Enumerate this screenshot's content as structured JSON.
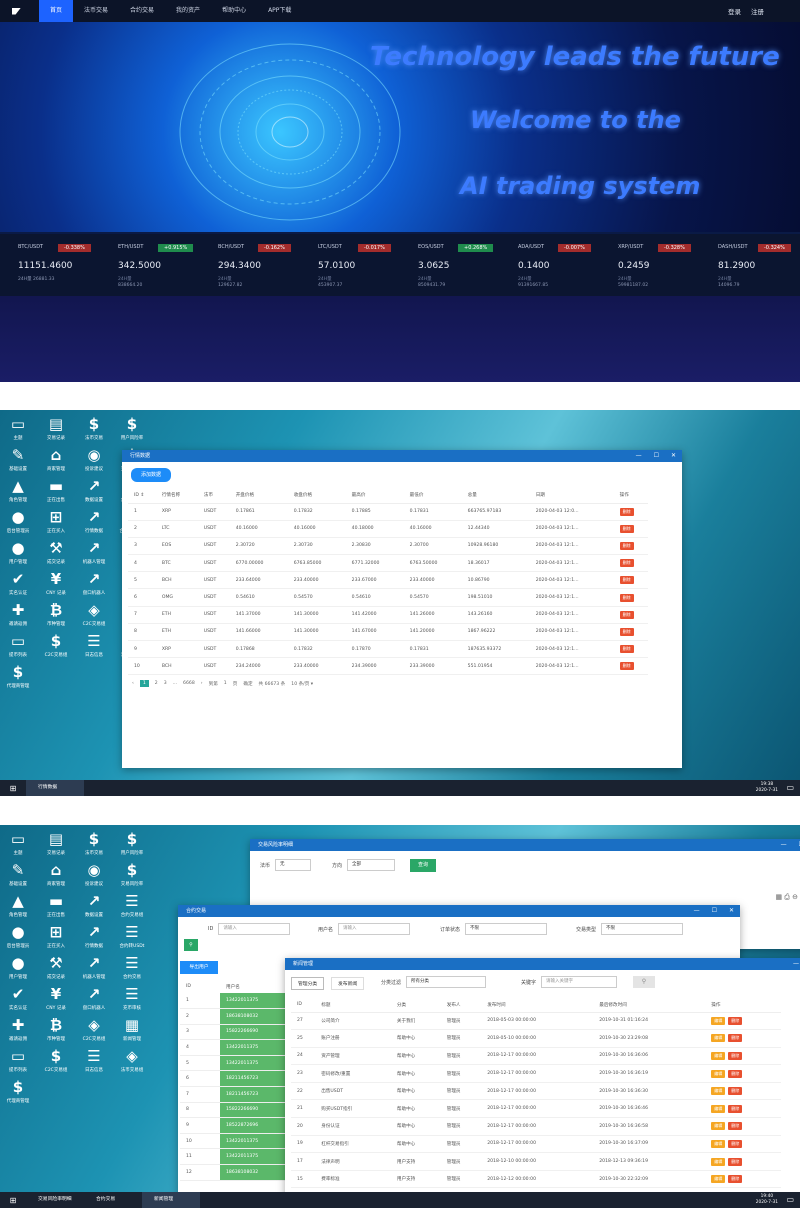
{
  "site": {
    "nav": [
      "首页",
      "法币交易",
      "合约交易",
      "我的资产",
      "帮助中心",
      "APP下载"
    ],
    "auth": [
      "登录",
      "注册"
    ],
    "hero_lines": [
      "Technology leads the future",
      "Welcome to the",
      "AI trading system"
    ],
    "tickers": [
      {
        "sym": "BTC/USDT",
        "chg": "-0.338%",
        "dir": "dn",
        "price": "11151.4600",
        "vol_label": "24H量",
        "vol": "24H量 26881.33"
      },
      {
        "sym": "ETH/USDT",
        "chg": "+0.915%",
        "dir": "up",
        "price": "342.5000",
        "vol_label": "24H量",
        "vol": "838664.20"
      },
      {
        "sym": "BCH/USDT",
        "chg": "-0.162%",
        "dir": "dn",
        "price": "294.3400",
        "vol_label": "24H量",
        "vol": "129627.82"
      },
      {
        "sym": "LTC/USDT",
        "chg": "-0.017%",
        "dir": "dn",
        "price": "57.0100",
        "vol_label": "24H量",
        "vol": "453907.37"
      },
      {
        "sym": "EOS/USDT",
        "chg": "+0.268%",
        "dir": "up",
        "price": "3.0625",
        "vol_label": "24H量",
        "vol": "8509431.79"
      },
      {
        "sym": "ADA/USDT",
        "chg": "-0.007%",
        "dir": "dn",
        "price": "0.1400",
        "vol_label": "24H量",
        "vol": "91391667.85"
      },
      {
        "sym": "XRP/USDT",
        "chg": "-0.328%",
        "dir": "dn",
        "price": "0.2459",
        "vol_label": "24H量",
        "vol": "59981187.02"
      },
      {
        "sym": "DASH/USDT",
        "chg": "-0.324%",
        "dir": "dn",
        "price": "81.2900",
        "vol_label": "24H量",
        "vol": "14096.79"
      }
    ]
  },
  "desktop_icons": [
    {
      "label": "主题",
      "icon": "monitor-icon",
      "g": "▭"
    },
    {
      "label": "交易记录",
      "icon": "document-icon",
      "g": "▤"
    },
    {
      "label": "法币交易",
      "icon": "dollar-icon",
      "g": "$"
    },
    {
      "label": "用户风险率",
      "icon": "dollar-icon",
      "g": "$"
    },
    {
      "label": "基础设置",
      "icon": "wrench-icon",
      "g": "✎"
    },
    {
      "label": "商家管理",
      "icon": "bank-icon",
      "g": "⌂"
    },
    {
      "label": "投诉建议",
      "icon": "broadcast-icon",
      "g": "◉"
    },
    {
      "label": "交易风险率",
      "icon": "dollar-icon",
      "g": "$"
    },
    {
      "label": "角色管理",
      "icon": "graduation-icon",
      "g": "▲"
    },
    {
      "label": "正在出售",
      "icon": "tray-icon",
      "g": "▬"
    },
    {
      "label": "数据设置",
      "icon": "chart-icon",
      "g": "↗"
    },
    {
      "label": "合约交易组",
      "icon": "list-icon",
      "g": "☰"
    },
    {
      "label": "后台管理员",
      "icon": "user-icon",
      "g": "●"
    },
    {
      "label": "正在买入",
      "icon": "cart-icon",
      "g": "⊞"
    },
    {
      "label": "行情数据",
      "icon": "chart-icon",
      "g": "↗"
    },
    {
      "label": "合约转USDt",
      "icon": "list-icon",
      "g": "☰"
    },
    {
      "label": "用户管理",
      "icon": "users-icon",
      "g": "●"
    },
    {
      "label": "成交记录",
      "icon": "gavel-icon",
      "g": "⚒"
    },
    {
      "label": "机器人管理",
      "icon": "chart-icon",
      "g": "↗"
    },
    {
      "label": "合约交易",
      "icon": "list-icon",
      "g": "☰"
    },
    {
      "label": "实名认证",
      "icon": "check-icon",
      "g": "✔"
    },
    {
      "label": "CNY 记录",
      "icon": "yen-icon",
      "g": "¥"
    },
    {
      "label": "盘口机器人",
      "icon": "chart-icon",
      "g": "↗"
    },
    {
      "label": "充币审核",
      "icon": "list-icon",
      "g": "☰"
    },
    {
      "label": "邀请返佣",
      "icon": "user-plus-icon",
      "g": "✚"
    },
    {
      "label": "币种管理",
      "icon": "bitcoin-icon",
      "g": "₿"
    },
    {
      "label": "C2C交易组",
      "icon": "c2c-icon",
      "g": "◈"
    },
    {
      "label": "新闻管理",
      "icon": "news-icon",
      "g": "▦"
    },
    {
      "label": "提币列表",
      "icon": "card-icon",
      "g": "▭"
    },
    {
      "label": "C2C交易组",
      "icon": "dollar-icon",
      "g": "$"
    },
    {
      "label": "日志信息",
      "icon": "list-icon",
      "g": "☰"
    },
    {
      "label": "法币交易组",
      "icon": "c2c-icon",
      "g": "◈"
    },
    {
      "label": "代理商管理",
      "icon": "dollar-icon",
      "g": "$"
    }
  ],
  "win_market": {
    "title": "行情数据",
    "add_label": "添加数据",
    "headers": [
      "ID ⇕",
      "行情名称",
      "法币",
      "开盘价格",
      "收盘价格",
      "最高价",
      "最低价",
      "总量",
      "日期",
      "操作"
    ],
    "rows": [
      [
        "1",
        "XRP",
        "USDT",
        "0.17861",
        "0.17832",
        "0.17885",
        "0.17831",
        "663765.97183",
        "2020-04-03 12:0..."
      ],
      [
        "2",
        "LTC",
        "USDT",
        "40.16000",
        "40.16000",
        "40.18000",
        "40.16000",
        "12.44340",
        "2020-04-03 12:1..."
      ],
      [
        "3",
        "EOS",
        "USDT",
        "2.30720",
        "2.30730",
        "2.30830",
        "2.30700",
        "10928.96180",
        "2020-04-03 12:1..."
      ],
      [
        "4",
        "BTC",
        "USDT",
        "6770.00000",
        "6763.85000",
        "6771.32000",
        "6763.50000",
        "18.36017",
        "2020-04-03 12:1..."
      ],
      [
        "5",
        "BCH",
        "USDT",
        "233.64000",
        "233.40000",
        "233.67000",
        "233.40000",
        "10.86790",
        "2020-04-03 12:1..."
      ],
      [
        "6",
        "OMG",
        "USDT",
        "0.54610",
        "0.54570",
        "0.54610",
        "0.54570",
        "198.51010",
        "2020-04-03 12:1..."
      ],
      [
        "7",
        "ETH",
        "USDT",
        "141.37000",
        "141.30000",
        "141.42000",
        "141.26000",
        "143.26160",
        "2020-04-03 12:1..."
      ],
      [
        "8",
        "ETH",
        "USDT",
        "141.66000",
        "141.30000",
        "141.67000",
        "141.20000",
        "1867.96222",
        "2020-04-03 12:1..."
      ],
      [
        "9",
        "XRP",
        "USDT",
        "0.17868",
        "0.17832",
        "0.17870",
        "0.17831",
        "187635.93372",
        "2020-04-03 12:1..."
      ],
      [
        "10",
        "BCH",
        "USDT",
        "234.24000",
        "233.40000",
        "234.39000",
        "233.39000",
        "551.01954",
        "2020-04-03 12:1..."
      ]
    ],
    "del_label": "删除",
    "pager": {
      "pages": [
        "1",
        "2",
        "3",
        "...",
        "6668"
      ],
      "goto": "到第",
      "page_input": "1",
      "page_unit": "页",
      "confirm": "确定",
      "total": "共 66673 条",
      "per_page": "10 条/页 ▾"
    }
  },
  "taskbar1": {
    "item": "行情数据",
    "time": "19:38",
    "date": "2020-7-31"
  },
  "win_risk": {
    "title": "交易风险率明细",
    "f1_label": "法币",
    "f1_value": "无",
    "f2_label": "方向",
    "f2_value": "全部",
    "query": "查询"
  },
  "win_contract": {
    "title": "合约交易",
    "id_label": "ID",
    "id_ph": "请输入",
    "user_label": "用户名",
    "user_ph": "请输入",
    "status_label": "订单状态",
    "status_value": "不限",
    "type_label": "交易类型",
    "type_value": "不限",
    "export": "导出用户",
    "col_id": "ID",
    "col_user": "用户名",
    "rows": [
      [
        "1",
        "13422011375"
      ],
      [
        "2",
        "18638108032"
      ],
      [
        "3",
        "15822266690"
      ],
      [
        "4",
        "13422011375"
      ],
      [
        "5",
        "13422011375"
      ],
      [
        "6",
        "18211456723"
      ],
      [
        "7",
        "18211456723"
      ],
      [
        "8",
        "15822266690"
      ],
      [
        "9",
        "18522872696"
      ],
      [
        "10",
        "13422011375"
      ],
      [
        "11",
        "13422011375"
      ],
      [
        "12",
        "18638108032"
      ]
    ]
  },
  "win_news": {
    "title": "新闻管理",
    "tab1": "管理分类",
    "tab2": "发布新闻",
    "filter_label": "分类过滤",
    "filter_value": "所有分类",
    "kw_label": "关键字",
    "kw_ph": "请输入关键字",
    "headers": [
      "ID",
      "标题",
      "分类",
      "发布人",
      "发布时间",
      "最后修改时间",
      "操作"
    ],
    "rows": [
      [
        "27",
        "公司简介",
        "关于我们",
        "管理员",
        "2018-05-03 00:00:00",
        "2019-10-31 01:16:24"
      ],
      [
        "25",
        "账户注册",
        "帮助中心",
        "管理员",
        "2018-05-10 00:00:00",
        "2019-10-30 23:29:08"
      ],
      [
        "24",
        "资产管理",
        "帮助中心",
        "管理员",
        "2018-12-17 00:00:00",
        "2019-10-30 16:36:06"
      ],
      [
        "23",
        "密码修改/重置",
        "帮助中心",
        "管理员",
        "2018-12-17 00:00:00",
        "2019-10-30 16:36:19"
      ],
      [
        "22",
        "出售USDT",
        "帮助中心",
        "管理员",
        "2018-12-17 00:00:00",
        "2019-10-30 16:36:30"
      ],
      [
        "21",
        "购买USDT指引",
        "帮助中心",
        "管理员",
        "2018-12-17 00:00:00",
        "2019-10-30 16:36:46"
      ],
      [
        "20",
        "身份认证",
        "帮助中心",
        "管理员",
        "2018-12-17 00:00:00",
        "2019-10-30 16:36:58"
      ],
      [
        "19",
        "杠杆交易指引",
        "帮助中心",
        "管理员",
        "2018-12-17 00:00:00",
        "2019-10-30 16:37:09"
      ],
      [
        "17",
        "法律声明",
        "用户支持",
        "管理员",
        "2018-12-10 00:00:00",
        "2018-12-13 09:36:19"
      ],
      [
        "15",
        "费率标准",
        "用户支持",
        "管理员",
        "2018-12-12 00:00:00",
        "2019-10-30 22:32:09"
      ]
    ],
    "edit": "编辑",
    "del": "删除"
  },
  "taskbar2": {
    "items": [
      "交易风险率明细",
      "合约交易",
      "新闻管理"
    ],
    "time": "19:40",
    "date": "2020-7-31"
  }
}
